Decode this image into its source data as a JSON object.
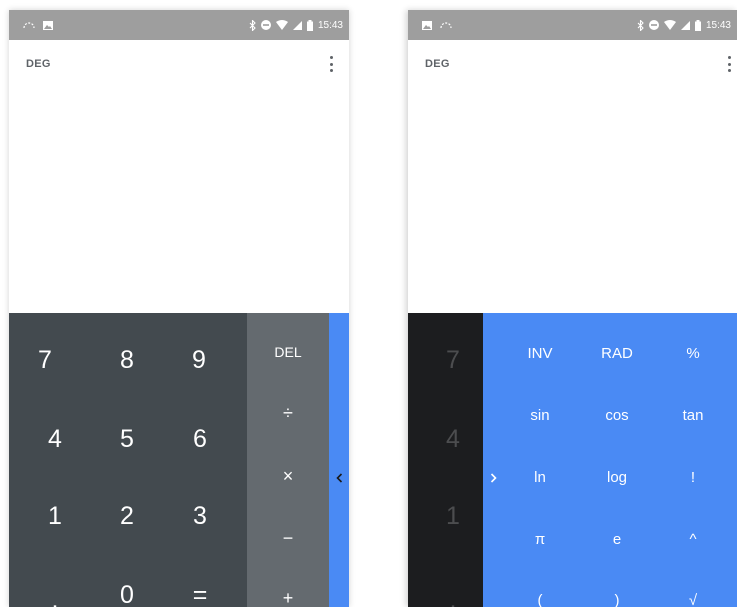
{
  "left_screen": {
    "status": {
      "time": "15:43"
    },
    "mode": "DEG",
    "numpad": [
      [
        "7",
        "8",
        "9"
      ],
      [
        "4",
        "5",
        "6"
      ],
      [
        "1",
        "2",
        "3"
      ],
      [
        ",",
        "0",
        "="
      ]
    ],
    "ops": [
      "DEL",
      "÷",
      "×",
      "−",
      "+"
    ]
  },
  "right_screen": {
    "status": {
      "time": "15:43"
    },
    "mode": "DEG",
    "numpad_col": [
      "7",
      "4",
      "1",
      ","
    ],
    "advanced": [
      [
        "INV",
        "RAD",
        "%"
      ],
      [
        "sin",
        "cos",
        "tan"
      ],
      [
        "ln",
        "log",
        "!"
      ],
      [
        "π",
        "e",
        "^"
      ],
      [
        "(",
        ")",
        "√"
      ]
    ]
  },
  "colors": {
    "status_bar": "#9e9e9e",
    "numpad": "#434a4f",
    "numpad_dim": "#1c1d1f",
    "ops": "#646a6f",
    "advanced": "#4a8af4"
  }
}
